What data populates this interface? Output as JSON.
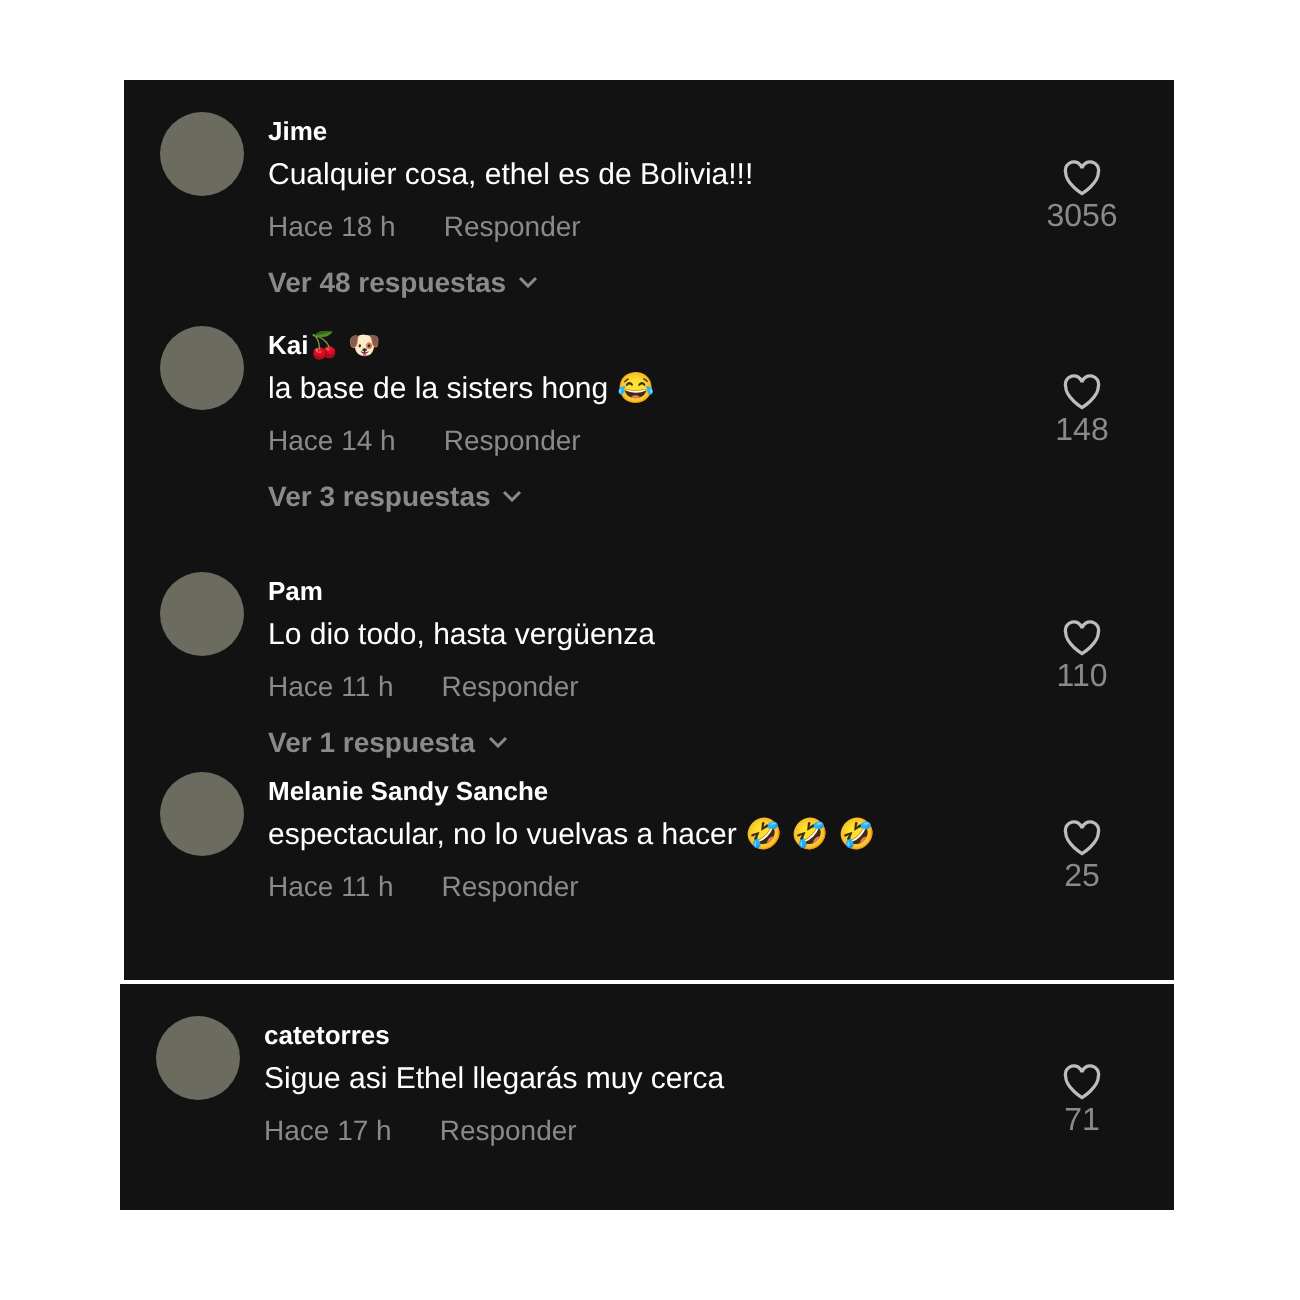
{
  "strips": [
    {
      "comments": [
        {
          "user": "Jime",
          "text": "Cualquier cosa, ethel es de Bolivia!!!",
          "time": "Hace 18 h",
          "reply": "Responder",
          "likes": "3056",
          "replies": "Ver 48 respuestas"
        },
        {
          "user": "Kai🍒 🐶",
          "text": "la base de la sisters hong 😂",
          "time": "Hace 14 h",
          "reply": "Responder",
          "likes": "148",
          "replies": "Ver 3 respuestas"
        }
      ]
    },
    {
      "comments": [
        {
          "user": "Pam",
          "text": "Lo dio todo, hasta vergüenza",
          "time": "Hace 11 h",
          "reply": "Responder",
          "likes": "110",
          "replies": "Ver 1 respuesta"
        },
        {
          "user": "Melanie Sandy Sanche",
          "text": "espectacular, no lo vuelvas a hacer 🤣 🤣 🤣",
          "time": "Hace 11 h",
          "reply": "Responder",
          "likes": "25"
        }
      ]
    },
    {
      "comments": [
        {
          "user": "catetorres",
          "text": "Sigue asi Ethel llegarás muy cerca",
          "time": "Hace 17 h",
          "reply": "Responder",
          "likes": "71"
        }
      ]
    }
  ]
}
